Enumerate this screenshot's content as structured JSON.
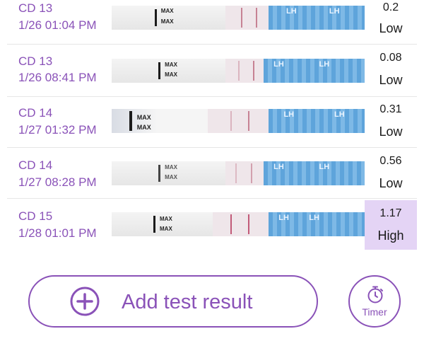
{
  "entries": [
    {
      "cycle_day": "CD 13",
      "datetime": "1/26  01:04 PM",
      "value": "0.2",
      "level": "Low",
      "brand": "LH"
    },
    {
      "cycle_day": "CD 13",
      "datetime": "1/26  08:41 PM",
      "value": "0.08",
      "level": "Low",
      "brand": "LH"
    },
    {
      "cycle_day": "CD 14",
      "datetime": "1/27  01:32 PM",
      "value": "0.31",
      "level": "Low",
      "brand": "LH"
    },
    {
      "cycle_day": "CD 14",
      "datetime": "1/27  08:28 PM",
      "value": "0.56",
      "level": "Low",
      "brand": "LH"
    },
    {
      "cycle_day": "CD 15",
      "datetime": "1/28  01:01 PM",
      "value": "1.17",
      "level": "High",
      "brand": "LH"
    }
  ],
  "strip_label": "MAX",
  "add_button": {
    "label": "Add test result",
    "icon": "plus-circle-icon"
  },
  "timer_button": {
    "label": "Timer",
    "icon": "stopwatch-icon"
  },
  "colors": {
    "accent": "#8a52b8",
    "high_bg": "#e4d4f5",
    "strip_blue": "#5ea4db"
  }
}
